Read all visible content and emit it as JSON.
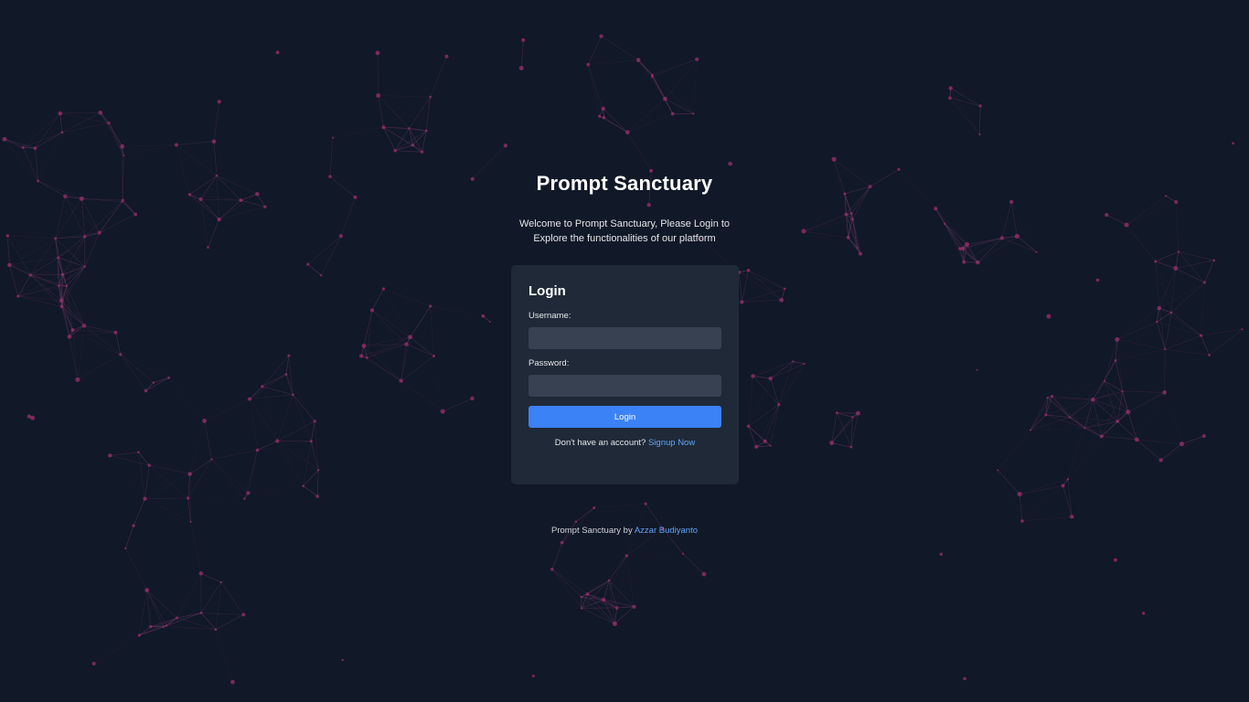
{
  "app": {
    "title": "Prompt Sanctuary",
    "welcome_line1": "Welcome to Prompt Sanctuary, Please Login to",
    "welcome_line2": "Explore the functionalities of our platform"
  },
  "login_form": {
    "heading": "Login",
    "username_label": "Username:",
    "username_value": "",
    "password_label": "Password:",
    "password_value": "",
    "submit_label": "Login",
    "signup_prompt": "Don't have an account?",
    "signup_link": "Signup Now"
  },
  "footer": {
    "text": "Prompt Sanctuary by",
    "author_link": "Azzar Budiyanto"
  },
  "colors": {
    "background": "#111827",
    "card": "#1f2937",
    "input": "#374151",
    "accent": "#3b82f6",
    "link": "#60a5fa",
    "network_line": "#6b3a63",
    "network_node": "#9d2f6e"
  },
  "background": {
    "type": "particle-network"
  }
}
